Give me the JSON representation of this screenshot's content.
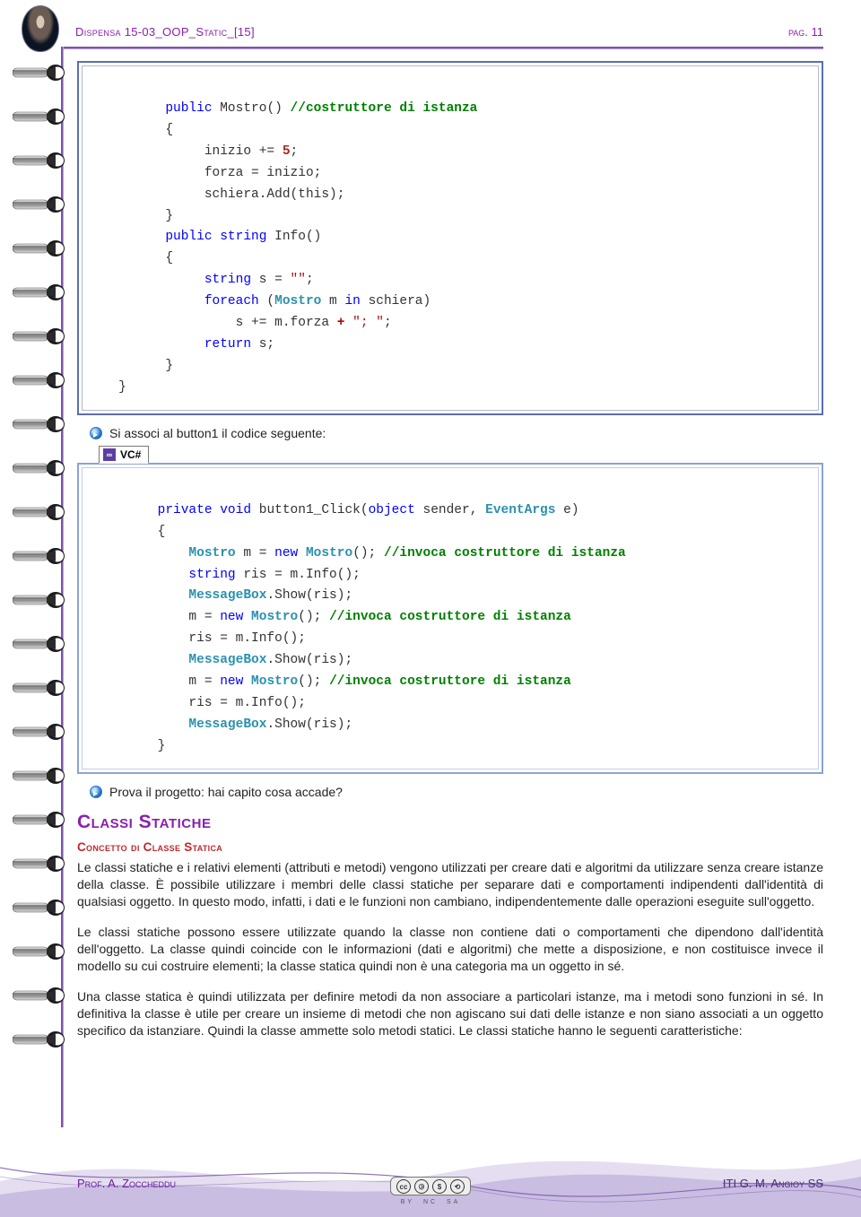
{
  "header": {
    "title": "Dispensa 15-03_OOP_Static_[15]",
    "page_label": "pag. 11"
  },
  "code1": {
    "l1a": "         public",
    "l1b": " Mostro() ",
    "l1c": "//costruttore di istanza",
    "l2": "         {",
    "l3a": "              inizio += ",
    "l3b": "5",
    "l3c": ";",
    "l4": "              forza = inizio;",
    "l5": "              schiera.Add(this);",
    "l6": "         }",
    "l7a": "         public",
    "l7b": " string",
    "l7c": " Info()",
    "l8": "         {",
    "l9a": "              string",
    "l9b": " s = ",
    "l9c": "\"\"",
    "l9d": ";",
    "l10a": "              foreach",
    "l10b": " (",
    "l10c": "Mostro",
    "l10d": " m ",
    "l10e": "in",
    "l10f": " schiera)",
    "l11a": "                  s += m.forza ",
    "l11b": "+ ",
    "l11c": "\"; \"",
    "l11d": ";",
    "l12a": "              return",
    "l12b": " s;",
    "l13": "         }",
    "l14": "   }"
  },
  "bullet1": "Si associ al button1 il codice seguente:",
  "tab": {
    "label": "VC#"
  },
  "code2": {
    "l1a": "        private",
    "l1b": " void",
    "l1c": " button1_Click(",
    "l1d": "object",
    "l1e": " sender, ",
    "l1f": "EventArgs",
    "l1g": " e)",
    "l2": "        {",
    "l3a": "            Mostro",
    "l3b": " m = ",
    "l3c": "new",
    "l3d": " Mostro",
    "l3e": "(); ",
    "l3f": "//invoca costruttore di istanza",
    "l4a": "            string",
    "l4b": " ris = m.Info();",
    "l5a": "            MessageBox",
    "l5b": ".Show(ris);",
    "l6a": "            m = ",
    "l6b": "new",
    "l6c": " Mostro",
    "l6d": "(); ",
    "l6e": "//invoca costruttore di istanza",
    "l7": "            ris = m.Info();",
    "l8a": "            MessageBox",
    "l8b": ".Show(ris);",
    "l9a": "            m = ",
    "l9b": "new",
    "l9c": " Mostro",
    "l9d": "(); ",
    "l9e": "//invoca costruttore di istanza",
    "l10": "            ris = m.Info();",
    "l11a": "            MessageBox",
    "l11b": ".Show(ris);",
    "l12": "        }"
  },
  "bullet2": "Prova il progetto: hai capito cosa accade?",
  "section": {
    "h2": "Classi Statiche",
    "h3": "Concetto di Classe Statica",
    "p1": "Le classi statiche e i relativi elementi (attributi e metodi) vengono utilizzati per creare dati e algoritmi da utilizzare senza creare istanze della classe. È possibile utilizzare i membri delle classi statiche per separare dati e comportamenti indipendenti dall'identità di qualsiasi oggetto. In questo modo, infatti, i dati e le funzioni non cambiano, indipendentemente dalle operazioni eseguite sull'oggetto.",
    "p2": "Le classi statiche possono essere utilizzate quando la classe non contiene dati o comportamenti che dipendono dall'identità dell'oggetto. La classe quindi coincide con le informazioni (dati e algoritmi) che mette a disposizione, e non costituisce invece il modello su cui costruire elementi; la classe statica quindi non è una categoria ma un oggetto in sé.",
    "p3": "Una classe statica è quindi utilizzata per definire metodi da non associare a particolari istanze, ma i metodi sono funzioni in sé. In definitiva la classe è utile per creare un insieme di metodi che non agiscano sui dati delle istanze e non siano associati a un oggetto specifico da istanziare. Quindi la classe ammette solo metodi statici. Le classi statiche hanno le seguenti caratteristiche:"
  },
  "footer": {
    "left": "Prof. A. Zoccheddu",
    "right": "ITI G. M. Angioy SS",
    "cc_by": "BY",
    "cc_nc": "NC",
    "cc_sa": "SA"
  }
}
